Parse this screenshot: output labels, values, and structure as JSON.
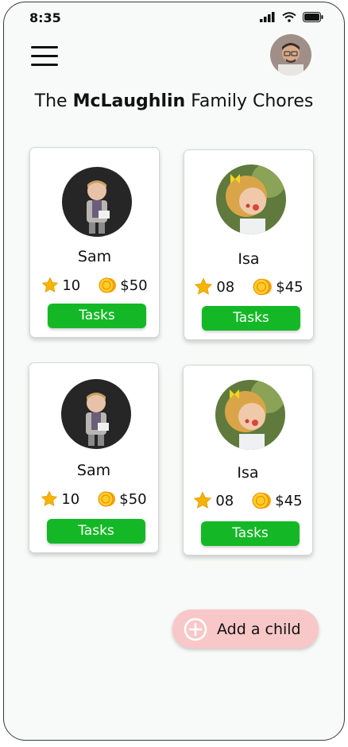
{
  "status": {
    "time": "8:35"
  },
  "header": {
    "title_prefix": "The ",
    "title_family": "McLaughlin",
    "title_suffix": " Family Chores"
  },
  "children": [
    {
      "name": "Sam",
      "stars": "10",
      "money": "$50",
      "tasks_label": "Tasks"
    },
    {
      "name": "Isa",
      "stars": "08",
      "money": "$45",
      "tasks_label": "Tasks"
    },
    {
      "name": "Sam",
      "stars": "10",
      "money": "$50",
      "tasks_label": "Tasks"
    },
    {
      "name": "Isa",
      "stars": "08",
      "money": "$45",
      "tasks_label": "Tasks"
    }
  ],
  "add_child": {
    "label": "Add a child"
  },
  "colors": {
    "tasks_button": "#14b826",
    "add_button": "#f8c7c7",
    "star": "#f5b400",
    "coin": "#f7a600"
  },
  "icons": [
    "menu-icon",
    "signal-icon",
    "wifi-icon",
    "battery-icon",
    "star-icon",
    "coin-icon",
    "plus-circle-icon"
  ]
}
